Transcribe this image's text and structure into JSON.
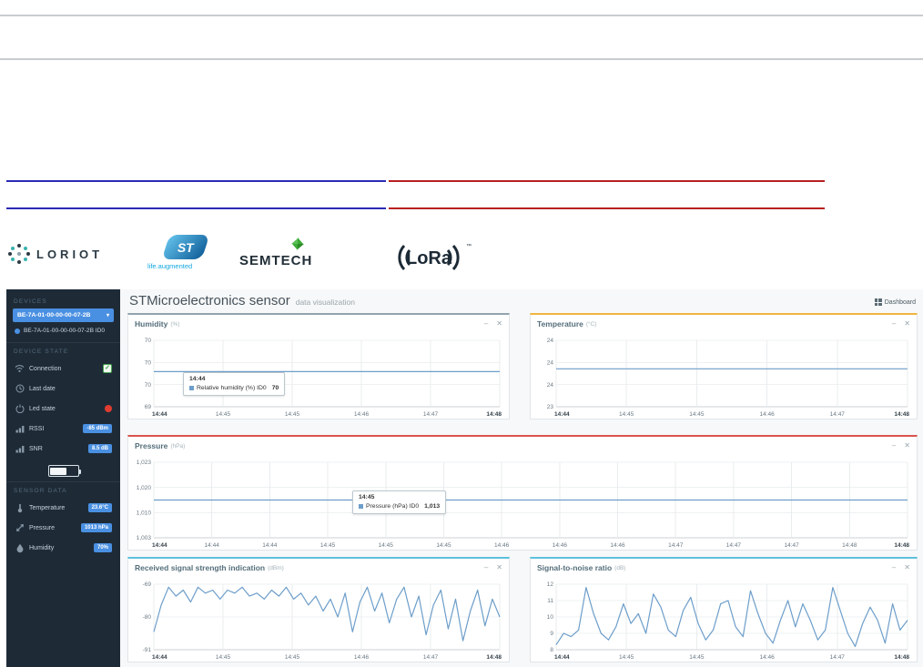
{
  "icons": {
    "minimize": "–",
    "close": "✕",
    "caret": "▾",
    "check": "✓"
  },
  "logos": {
    "loriot": "LORIOT",
    "st_name": "ST",
    "st_tagline": "life.augmented",
    "semtech": "SEMTECH",
    "lora": "LoRa",
    "lora_tm": "™"
  },
  "sidebar": {
    "badge_color": "#4a90e2",
    "sections": {
      "devices": "DEVICES",
      "device_state": "DEVICE STATE",
      "sensor_data": "SENSOR DATA"
    },
    "device_dropdown": "BE-7A-01-00-00-00-07-2B",
    "device_item": "BE-7A-01-00-00-00-07-2B ID0",
    "state_items": [
      {
        "label": "Connection",
        "icon": "wifi-icon",
        "status": "ok"
      },
      {
        "label": "Last date",
        "icon": "clock-icon"
      },
      {
        "label": "Led state",
        "icon": "led-icon",
        "status": "red"
      },
      {
        "label": "RSSI",
        "icon": "signal-icon",
        "badge": "-85 dBm"
      },
      {
        "label": "SNR",
        "icon": "signal-icon",
        "badge": "8.5 dB"
      }
    ],
    "sensor_items": [
      {
        "label": "Temperature",
        "icon": "thermometer-icon",
        "badge": "23.6°C"
      },
      {
        "label": "Pressure",
        "icon": "gauge-icon",
        "badge": "1013 hPa"
      },
      {
        "label": "Humidity",
        "icon": "droplet-icon",
        "badge": "70%"
      }
    ]
  },
  "header": {
    "title": "STMicroelectronics sensor",
    "subtitle": "data visualization",
    "dashboard_button": "Dashboard"
  },
  "chart_data": [
    {
      "type": "line",
      "title": "Humidity",
      "unit": "(%)",
      "accent": "#90a4ae",
      "series_color": "#6d9eca",
      "y_labels": [
        "70",
        "70",
        "70",
        "69"
      ],
      "x_labels": [
        "14:44",
        "14:45",
        "14:45",
        "14:46",
        "14:47",
        "14:48"
      ],
      "ylim": [
        69.1,
        70.8
      ],
      "values": [
        70,
        70
      ],
      "tooltip": {
        "time": "14:44",
        "label": "Relative humidity (%) ID0",
        "value": "70"
      }
    },
    {
      "type": "line",
      "title": "Temperature",
      "unit": "(°C)",
      "accent": "#f0b53e",
      "series_color": "#6d9eca",
      "y_labels": [
        "24",
        "24",
        "24",
        "23"
      ],
      "x_labels": [
        "14:44",
        "14:45",
        "14:45",
        "14:46",
        "14:47",
        "14:48"
      ],
      "ylim": [
        23.2,
        24.6
      ],
      "values": [
        24,
        24
      ]
    },
    {
      "type": "line",
      "title": "Pressure",
      "unit": "(hPa)",
      "accent": "#d9534f",
      "series_color": "#6d9eca",
      "y_labels": [
        "1,023",
        "1,020",
        "1,010",
        "1,003"
      ],
      "x_labels": [
        "14:44",
        "14:44",
        "14:44",
        "14:45",
        "14:45",
        "14:45",
        "14:46",
        "14:46",
        "14:46",
        "14:47",
        "14:47",
        "14:47",
        "14:48",
        "14:48"
      ],
      "ylim": [
        1003,
        1023
      ],
      "values": [
        1013,
        1013
      ],
      "tooltip": {
        "time": "14:45",
        "label": "Pressure (hPa) ID0",
        "value": "1,013"
      }
    },
    {
      "type": "line",
      "title": "Received signal strength indication",
      "unit": "(dBm)",
      "accent": "#5bc0de",
      "series_color": "#6d9eca",
      "y_labels": [
        "-69",
        "-80",
        "-91"
      ],
      "x_labels": [
        "14:44",
        "14:45",
        "14:45",
        "14:46",
        "14:47",
        "14:48"
      ],
      "ylim": [
        -91,
        -69
      ],
      "values": [
        -85,
        -76,
        -70,
        -73,
        -71,
        -75,
        -70,
        -72,
        -71,
        -74,
        -71,
        -72,
        -70,
        -73,
        -72,
        -74,
        -71,
        -73,
        -70,
        -74,
        -72,
        -76,
        -73,
        -78,
        -74,
        -80,
        -72,
        -85,
        -75,
        -70,
        -78,
        -72,
        -82,
        -74,
        -70,
        -80,
        -73,
        -86,
        -76,
        -71,
        -84,
        -74,
        -88,
        -78,
        -71,
        -83,
        -74,
        -80
      ]
    },
    {
      "type": "line",
      "title": "Signal-to-noise ratio",
      "unit": "(dB)",
      "accent": "#5bc0de",
      "series_color": "#6d9eca",
      "y_labels": [
        "12",
        "11",
        "10",
        "9",
        "8"
      ],
      "x_labels": [
        "14:44",
        "14:45",
        "14:45",
        "14:46",
        "14:47",
        "14:48"
      ],
      "ylim": [
        8,
        12
      ],
      "values": [
        8.3,
        9.0,
        8.8,
        9.2,
        11.8,
        10.2,
        9.0,
        8.6,
        9.4,
        10.8,
        9.6,
        10.2,
        9.0,
        11.4,
        10.6,
        9.2,
        8.8,
        10.4,
        11.2,
        9.6,
        8.6,
        9.2,
        10.8,
        11.0,
        9.4,
        8.8,
        11.6,
        10.2,
        9.0,
        8.4,
        9.8,
        11.0,
        9.4,
        10.8,
        9.8,
        8.6,
        9.2,
        11.8,
        10.4,
        9.0,
        8.2,
        9.6,
        10.6,
        9.8,
        8.4,
        10.8,
        9.2,
        9.8
      ]
    }
  ]
}
